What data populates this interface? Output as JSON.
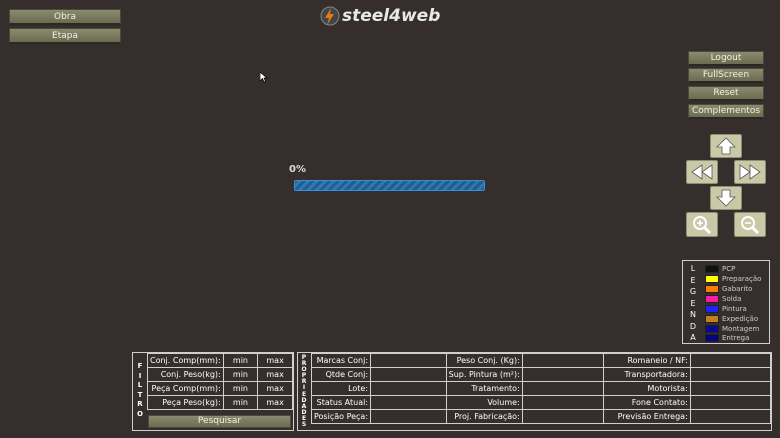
{
  "top_left": {
    "obra_label": "Obra",
    "etapa_label": "Etapa"
  },
  "logo": {
    "text": "steel4web"
  },
  "right_menu": {
    "logout": "Logout",
    "fullscreen": "FullScreen",
    "reset": "Reset",
    "complementos": "Complementos"
  },
  "progress": {
    "label": "0%",
    "value": 0
  },
  "navigation": {
    "up": "arrow-up-icon",
    "left": "fast-backward-icon",
    "right": "fast-forward-icon",
    "down": "arrow-down-icon",
    "zoom_in": "zoom-in-icon",
    "zoom_out": "zoom-out-icon"
  },
  "legend": {
    "title": [
      "L",
      "E",
      "G",
      "E",
      "N",
      "D",
      "A"
    ],
    "items": [
      {
        "label": "PCP",
        "color": "#111111"
      },
      {
        "label": "Preparação",
        "color": "#ffff00"
      },
      {
        "label": "Gabarito",
        "color": "#ff7a00"
      },
      {
        "label": "Solda",
        "color": "#ff1aa3"
      },
      {
        "label": "Pintura",
        "color": "#2222ff"
      },
      {
        "label": "Expedição",
        "color": "#c08020"
      },
      {
        "label": "Montagem",
        "color": "#0a0a8a"
      },
      {
        "label": "Entrega",
        "color": "#06067a"
      }
    ]
  },
  "filter": {
    "title": [
      "F",
      "I",
      "L",
      "T",
      "R",
      "O"
    ],
    "rows": [
      {
        "label": "Conj. Comp(mm):",
        "min": "min",
        "max": "max"
      },
      {
        "label": "Conj. Peso(kg):",
        "min": "min",
        "max": "max"
      },
      {
        "label": "Peça Comp(mm):",
        "min": "min",
        "max": "max"
      },
      {
        "label": "Peça Peso(kg):",
        "min": "min",
        "max": "max"
      }
    ],
    "search_label": "Pesquisar"
  },
  "properties": {
    "title": [
      "P",
      "R",
      "O",
      "P",
      "R",
      "I",
      "E",
      "D",
      "A",
      "D",
      "E",
      "S"
    ],
    "rows": [
      [
        "Marcas Conj:",
        "",
        "Peso Conj. (Kg):",
        "",
        "Romaneio / NF:",
        ""
      ],
      [
        "Qtde Conj:",
        "",
        "Sup. Pintura (m²):",
        "",
        "Transportadora:",
        ""
      ],
      [
        "Lote:",
        "",
        "Tratamento:",
        "",
        "Motorista:",
        ""
      ],
      [
        "Status Atual:",
        "",
        "Volume:",
        "",
        "Fone Contato:",
        ""
      ],
      [
        "Posição Peça:",
        "",
        "Proj. Fabricação:",
        "",
        "Previsão Entrega:",
        ""
      ]
    ]
  }
}
